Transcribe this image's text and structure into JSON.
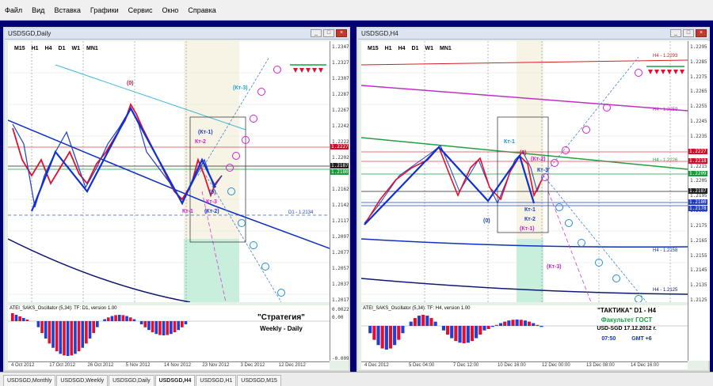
{
  "menu": [
    "Файл",
    "Вид",
    "Вставка",
    "Графики",
    "Сервис",
    "Окно",
    "Справка"
  ],
  "timeframes": [
    "M15",
    "H1",
    "H4",
    "D1",
    "W1",
    "MN1"
  ],
  "daily": {
    "title": "USDSGD,Daily",
    "osc_title": "ATEI_SAKS_Oscillator (5,34): TF: D1, version 1.00",
    "caption_line1": "\"Стратегия\"",
    "caption_line2": "Weekly - Daily",
    "d1_label": "D1 - 1.2134",
    "price_ticks": [
      "1.2347",
      "1.2327",
      "1.2307",
      "1.2287",
      "1.2267",
      "1.2242",
      "1.2222",
      "1.2202",
      "1.2182",
      "1.2162",
      "1.2142",
      "1.2117",
      "1.2097",
      "1.2077",
      "1.2057",
      "1.2037",
      "1.2017"
    ],
    "price_badges": [
      {
        "text": "1.2227",
        "color": "#d0102a"
      },
      {
        "text": "1.2187",
        "color": "#202020"
      },
      {
        "text": "1.2180",
        "color": "#1a9a3a"
      }
    ],
    "osc_ticks": [
      "0.00227",
      "0.00",
      "-0.00927"
    ],
    "time_ticks": [
      "4 Oct 2012",
      "17 Oct 2012",
      "26 Oct 2012",
      "5 Nov 2012",
      "14 Nov 2012",
      "23 Nov 2012",
      "3 Dec 2012",
      "12 Dec 2012"
    ],
    "labels": {
      "zero_top": "(0)",
      "kt1": "(Кт-1)",
      "kt2": "Кт-2",
      "kt3_top": "(Кт-3)",
      "kt3_mid": "Кт-3",
      "kt1_low": "Кт-1",
      "kt2_low": "(Кт-2)",
      "zero_low": "(0)"
    }
  },
  "h4": {
    "title": "USDSGD,H4",
    "osc_title": "ATEI_SAKS_Oscillator (5,34): TF: H4, version 1.00",
    "caption_title": "\"ТАКТИКА\"   D1 - H4",
    "caption_faculty": "Факультет ГОСТ",
    "caption_pair": "USD-SGD  17.12.2012 г.",
    "caption_time": "07:50",
    "caption_gmt": "GMT +6",
    "h4_labels": [
      "H4 - 1.2293",
      "H4 - 1.2259",
      "H4 - 1.2226",
      "H4 - 1.2158",
      "H4 - 1.2125"
    ],
    "price_ticks": [
      "1.2295",
      "1.2285",
      "1.2275",
      "1.2265",
      "1.2255",
      "1.2245",
      "1.2235",
      "1.2225",
      "1.2215",
      "1.2205",
      "1.2195",
      "1.2185",
      "1.2175",
      "1.2165",
      "1.2155",
      "1.2145",
      "1.2135",
      "1.2125"
    ],
    "price_badges": [
      {
        "text": "1.2227",
        "color": "#d0102a"
      },
      {
        "text": "1.2218",
        "color": "#d0102a"
      },
      {
        "text": "1.2209",
        "color": "#1a9a3a"
      },
      {
        "text": "1.2187",
        "color": "#202020"
      },
      {
        "text": "1.2180",
        "color": "#2040c0"
      },
      {
        "text": "1.2178",
        "color": "#2040c0"
      }
    ],
    "time_ticks": [
      "4 Dec 2012",
      "5 Dec 04:00",
      "7 Dec 12:00",
      "10 Dec 16:00",
      "12 Dec 00:00",
      "13 Dec 08:00",
      "14 Dec 16:00"
    ],
    "labels": {
      "kt1_top": "Кт-1",
      "zero_top": "(0)",
      "kt2_top": "(Кт-2)",
      "kt3": "Кт-3",
      "kt1_low": "Кт-1",
      "kt2_low": "Кт-2",
      "kt1_paren": "(Кт-1)",
      "zero_low": "(0)",
      "kt3_paren": "(Кт-3)"
    }
  },
  "tabs": [
    "USDSGD,Monthly",
    "USDSGD,Weekly",
    "USDSGD,Daily",
    "USDSGD,H4",
    "USDSGD,H1",
    "USDSGD,M15"
  ],
  "active_tab": "USDSGD,H4",
  "colors": {
    "bull": "#e01030",
    "bear": "#1030d0",
    "accent_green": "#18a040",
    "magenta": "#d020d0",
    "cyan": "#20a0d0"
  }
}
